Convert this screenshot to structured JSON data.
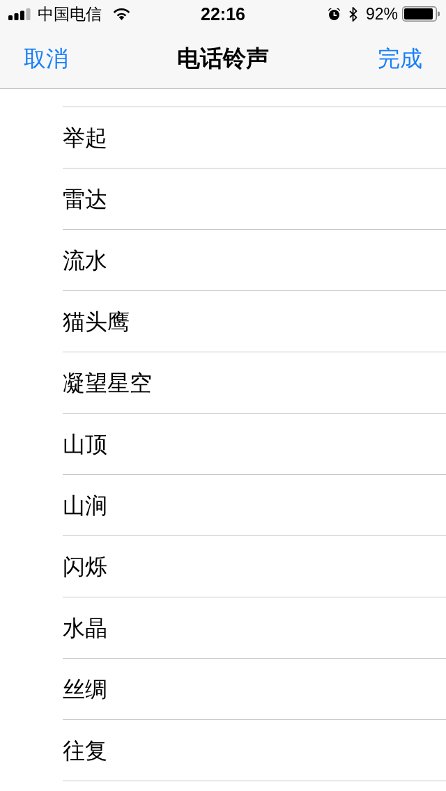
{
  "status_bar": {
    "carrier": "中国电信",
    "time": "22:16",
    "battery_text": "92%"
  },
  "nav_bar": {
    "cancel": "取消",
    "title": "电话铃声",
    "done": "完成"
  },
  "ringtones": [
    {
      "name": "举起",
      "selected": false
    },
    {
      "name": "雷达",
      "selected": false
    },
    {
      "name": "流水",
      "selected": false
    },
    {
      "name": "猫头鹰",
      "selected": false
    },
    {
      "name": "凝望星空",
      "selected": false
    },
    {
      "name": "山顶",
      "selected": false
    },
    {
      "name": "山涧",
      "selected": false
    },
    {
      "name": "闪烁",
      "selected": false
    },
    {
      "name": "水晶",
      "selected": false
    },
    {
      "name": "丝绸",
      "selected": false
    },
    {
      "name": "往复",
      "selected": false
    }
  ]
}
